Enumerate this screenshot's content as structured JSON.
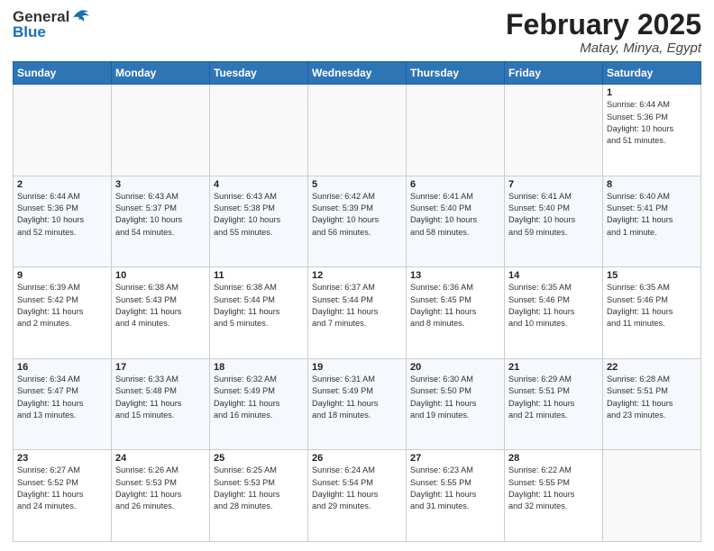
{
  "header": {
    "logo_general": "General",
    "logo_blue": "Blue",
    "month_title": "February 2025",
    "location": "Matay, Minya, Egypt"
  },
  "weekdays": [
    "Sunday",
    "Monday",
    "Tuesday",
    "Wednesday",
    "Thursday",
    "Friday",
    "Saturday"
  ],
  "weeks": [
    [
      {
        "day": "",
        "info": ""
      },
      {
        "day": "",
        "info": ""
      },
      {
        "day": "",
        "info": ""
      },
      {
        "day": "",
        "info": ""
      },
      {
        "day": "",
        "info": ""
      },
      {
        "day": "",
        "info": ""
      },
      {
        "day": "1",
        "info": "Sunrise: 6:44 AM\nSunset: 5:36 PM\nDaylight: 10 hours\nand 51 minutes."
      }
    ],
    [
      {
        "day": "2",
        "info": "Sunrise: 6:44 AM\nSunset: 5:36 PM\nDaylight: 10 hours\nand 52 minutes."
      },
      {
        "day": "3",
        "info": "Sunrise: 6:43 AM\nSunset: 5:37 PM\nDaylight: 10 hours\nand 54 minutes."
      },
      {
        "day": "4",
        "info": "Sunrise: 6:43 AM\nSunset: 5:38 PM\nDaylight: 10 hours\nand 55 minutes."
      },
      {
        "day": "5",
        "info": "Sunrise: 6:42 AM\nSunset: 5:39 PM\nDaylight: 10 hours\nand 56 minutes."
      },
      {
        "day": "6",
        "info": "Sunrise: 6:41 AM\nSunset: 5:40 PM\nDaylight: 10 hours\nand 58 minutes."
      },
      {
        "day": "7",
        "info": "Sunrise: 6:41 AM\nSunset: 5:40 PM\nDaylight: 10 hours\nand 59 minutes."
      },
      {
        "day": "8",
        "info": "Sunrise: 6:40 AM\nSunset: 5:41 PM\nDaylight: 11 hours\nand 1 minute."
      }
    ],
    [
      {
        "day": "9",
        "info": "Sunrise: 6:39 AM\nSunset: 5:42 PM\nDaylight: 11 hours\nand 2 minutes."
      },
      {
        "day": "10",
        "info": "Sunrise: 6:38 AM\nSunset: 5:43 PM\nDaylight: 11 hours\nand 4 minutes."
      },
      {
        "day": "11",
        "info": "Sunrise: 6:38 AM\nSunset: 5:44 PM\nDaylight: 11 hours\nand 5 minutes."
      },
      {
        "day": "12",
        "info": "Sunrise: 6:37 AM\nSunset: 5:44 PM\nDaylight: 11 hours\nand 7 minutes."
      },
      {
        "day": "13",
        "info": "Sunrise: 6:36 AM\nSunset: 5:45 PM\nDaylight: 11 hours\nand 8 minutes."
      },
      {
        "day": "14",
        "info": "Sunrise: 6:35 AM\nSunset: 5:46 PM\nDaylight: 11 hours\nand 10 minutes."
      },
      {
        "day": "15",
        "info": "Sunrise: 6:35 AM\nSunset: 5:46 PM\nDaylight: 11 hours\nand 11 minutes."
      }
    ],
    [
      {
        "day": "16",
        "info": "Sunrise: 6:34 AM\nSunset: 5:47 PM\nDaylight: 11 hours\nand 13 minutes."
      },
      {
        "day": "17",
        "info": "Sunrise: 6:33 AM\nSunset: 5:48 PM\nDaylight: 11 hours\nand 15 minutes."
      },
      {
        "day": "18",
        "info": "Sunrise: 6:32 AM\nSunset: 5:49 PM\nDaylight: 11 hours\nand 16 minutes."
      },
      {
        "day": "19",
        "info": "Sunrise: 6:31 AM\nSunset: 5:49 PM\nDaylight: 11 hours\nand 18 minutes."
      },
      {
        "day": "20",
        "info": "Sunrise: 6:30 AM\nSunset: 5:50 PM\nDaylight: 11 hours\nand 19 minutes."
      },
      {
        "day": "21",
        "info": "Sunrise: 6:29 AM\nSunset: 5:51 PM\nDaylight: 11 hours\nand 21 minutes."
      },
      {
        "day": "22",
        "info": "Sunrise: 6:28 AM\nSunset: 5:51 PM\nDaylight: 11 hours\nand 23 minutes."
      }
    ],
    [
      {
        "day": "23",
        "info": "Sunrise: 6:27 AM\nSunset: 5:52 PM\nDaylight: 11 hours\nand 24 minutes."
      },
      {
        "day": "24",
        "info": "Sunrise: 6:26 AM\nSunset: 5:53 PM\nDaylight: 11 hours\nand 26 minutes."
      },
      {
        "day": "25",
        "info": "Sunrise: 6:25 AM\nSunset: 5:53 PM\nDaylight: 11 hours\nand 28 minutes."
      },
      {
        "day": "26",
        "info": "Sunrise: 6:24 AM\nSunset: 5:54 PM\nDaylight: 11 hours\nand 29 minutes."
      },
      {
        "day": "27",
        "info": "Sunrise: 6:23 AM\nSunset: 5:55 PM\nDaylight: 11 hours\nand 31 minutes."
      },
      {
        "day": "28",
        "info": "Sunrise: 6:22 AM\nSunset: 5:55 PM\nDaylight: 11 hours\nand 32 minutes."
      },
      {
        "day": "",
        "info": ""
      }
    ]
  ]
}
